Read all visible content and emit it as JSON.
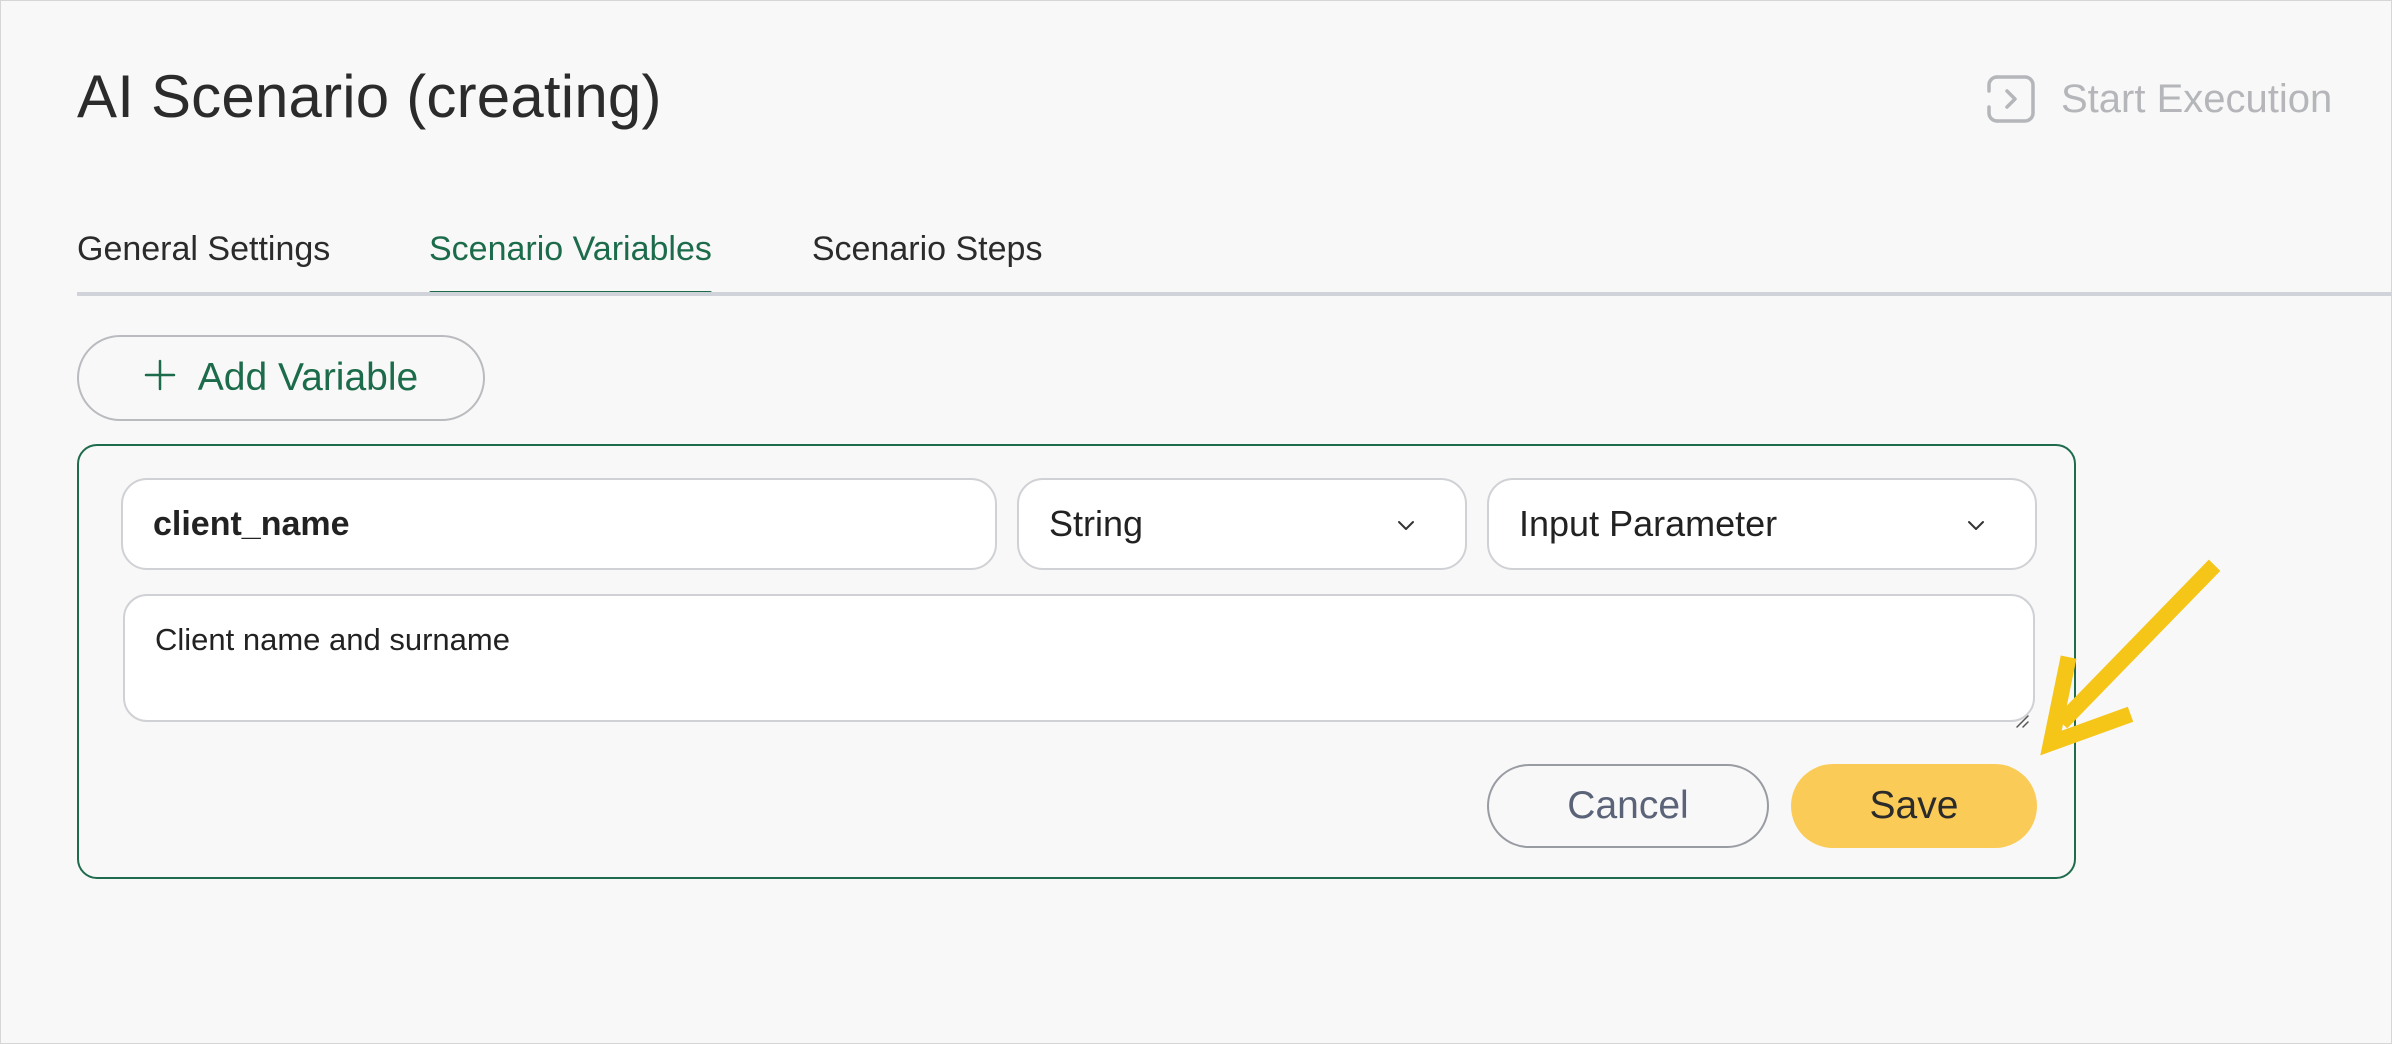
{
  "header": {
    "title": "AI Scenario (creating)",
    "start_execution_label": "Start Execution",
    "start_execution_icon": "play-frame-icon"
  },
  "tabs": [
    {
      "label": "General Settings",
      "active": false
    },
    {
      "label": "Scenario Variables",
      "active": true
    },
    {
      "label": "Scenario Steps",
      "active": false
    }
  ],
  "add_variable": {
    "label": "Add Variable",
    "icon": "plus-icon"
  },
  "variable_form": {
    "name_value": "client_name",
    "type_value": "String",
    "role_value": "Input Parameter",
    "description_value": "Client name and surname",
    "cancel_label": "Cancel",
    "save_label": "Save"
  },
  "colors": {
    "accent_green": "#1c6b4b",
    "save_yellow": "#fbcb57",
    "annotation_arrow": "#f5c518",
    "disabled_gray": "#b4b6ba"
  }
}
